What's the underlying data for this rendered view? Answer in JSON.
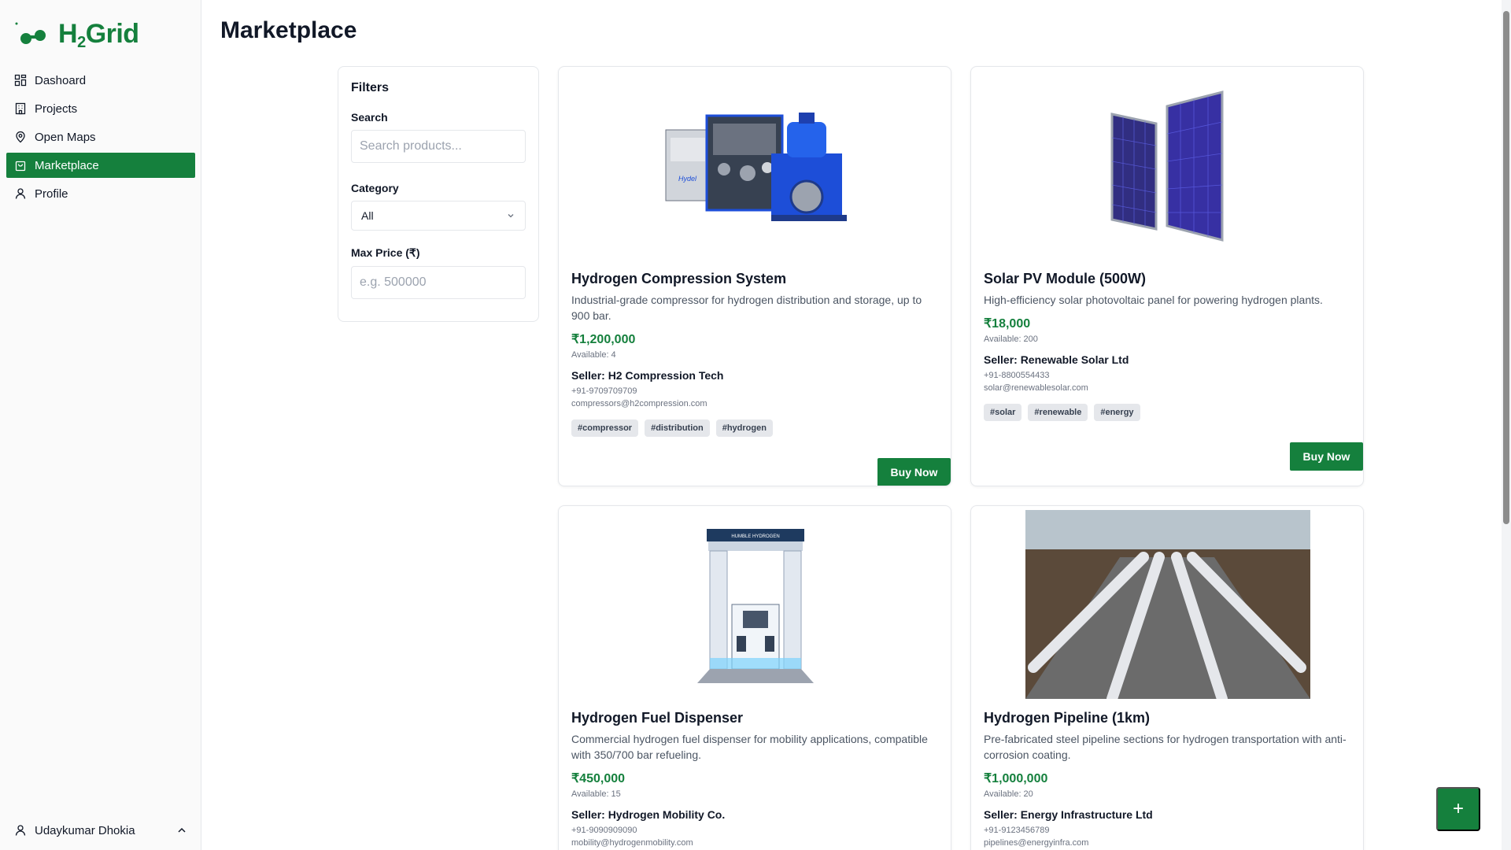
{
  "brand": {
    "name_prefix": "H",
    "name_sub": "2",
    "name_suffix": "Grid",
    "color": "#15803d"
  },
  "sidebar": {
    "items": [
      {
        "label": "Dashoard",
        "icon": "dashboard-icon",
        "active": false
      },
      {
        "label": "Projects",
        "icon": "building-icon",
        "active": false
      },
      {
        "label": "Open Maps",
        "icon": "map-pin-icon",
        "active": false
      },
      {
        "label": "Marketplace",
        "icon": "shopping-bag-icon",
        "active": true
      },
      {
        "label": "Profile",
        "icon": "user-icon",
        "active": false
      }
    ],
    "user": {
      "name": "Udaykumar Dhokia"
    }
  },
  "page": {
    "title": "Marketplace"
  },
  "filters": {
    "heading": "Filters",
    "search_label": "Search",
    "search_placeholder": "Search products...",
    "category_label": "Category",
    "category_value": "All",
    "max_price_label": "Max Price (₹)",
    "max_price_placeholder": "e.g. 500000"
  },
  "products": [
    {
      "title": "Hydrogen Compression System",
      "description": "Industrial-grade compressor for hydrogen distribution and storage, up to 900 bar.",
      "price": "₹1,200,000",
      "available": "Available: 4",
      "seller": "Seller: H2 Compression Tech",
      "phone": "+91-9709709709",
      "email": "compressors@h2compression.com",
      "tags": [
        "#compressor",
        "#distribution",
        "#hydrogen"
      ],
      "buy_label": "Buy Now",
      "image_icon": "compressor-image"
    },
    {
      "title": "Solar PV Module (500W)",
      "description": "High-efficiency solar photovoltaic panel for powering hydrogen plants.",
      "price": "₹18,000",
      "available": "Available: 200",
      "seller": "Seller: Renewable Solar Ltd",
      "phone": "+91-8800554433",
      "email": "solar@renewablesolar.com",
      "tags": [
        "#solar",
        "#renewable",
        "#energy"
      ],
      "buy_label": "Buy Now",
      "image_icon": "solar-panel-image"
    },
    {
      "title": "Hydrogen Fuel Dispenser",
      "description": "Commercial hydrogen fuel dispenser for mobility applications, compatible with 350/700 bar refueling.",
      "price": "₹450,000",
      "available": "Available: 15",
      "seller": "Seller: Hydrogen Mobility Co.",
      "phone": "+91-9090909090",
      "email": "mobility@hydrogenmobility.com",
      "image_icon": "fuel-dispenser-image",
      "image_label": "HUMBLE HYDROGEN"
    },
    {
      "title": "Hydrogen Pipeline (1km)",
      "description": "Pre-fabricated steel pipeline sections for hydrogen transportation with anti-corrosion coating.",
      "price": "₹1,000,000",
      "available": "Available: 20",
      "seller": "Seller: Energy Infrastructure Ltd",
      "phone": "+91-9123456789",
      "email": "pipelines@energyinfra.com",
      "image_icon": "pipeline-image"
    }
  ],
  "fab": {
    "label": "+"
  }
}
